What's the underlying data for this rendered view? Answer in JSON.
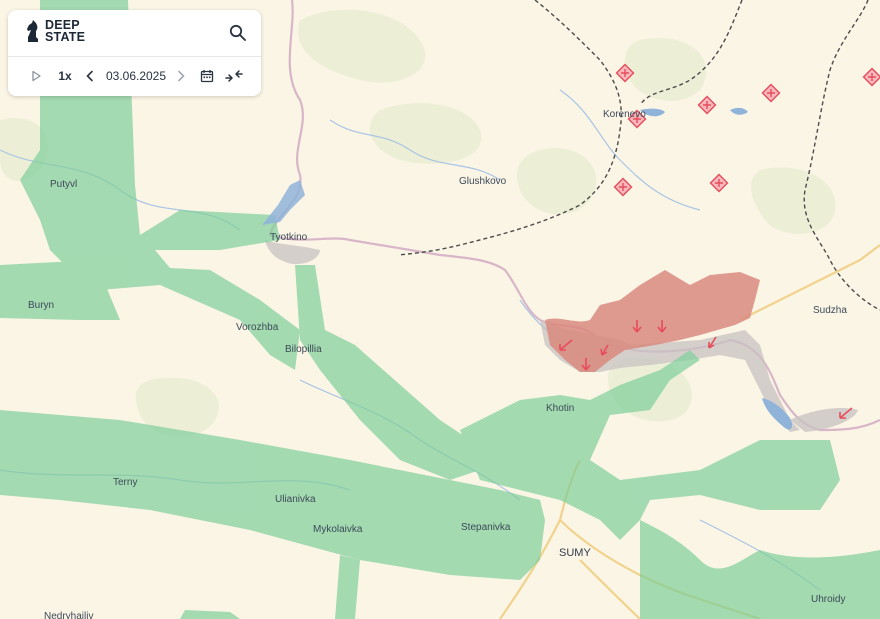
{
  "app": {
    "logo_line1": "DEEP",
    "logo_line2": "STATE"
  },
  "toolbar": {
    "speed_label": "1x",
    "date_value": "03.06.2025",
    "icons": [
      "play-icon",
      "chevron-left-icon",
      "chevron-right-icon",
      "calendar-icon",
      "compare-icon",
      "search-icon"
    ]
  },
  "map": {
    "places": [
      "Putyvl",
      "Buryn",
      "Tyotkino",
      "Glushkovo",
      "Korenevo",
      "Vorozhba",
      "Bilopillia",
      "Khotin",
      "Terny",
      "Ulianivka",
      "Mykolaivka",
      "Stepanivka",
      "SUMY",
      "Sudzha",
      "Uhroidy",
      "Nedryhailiv"
    ],
    "colors": {
      "background": "#fbf5e6",
      "liberated_zone": "#7fcf9a",
      "occupied_zone": "#d98a7f",
      "contested_zone": "#c9c3c1",
      "border": "#d6b4c6",
      "road": "#f3d48a",
      "water": "#8fb3d9",
      "attack_marker": "#e74c5a"
    }
  }
}
